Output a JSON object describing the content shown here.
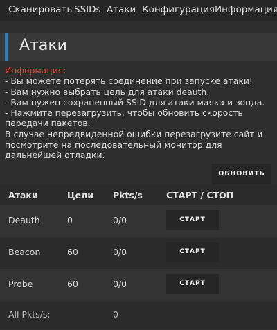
{
  "nav": {
    "items": [
      "Сканировать",
      "SSIDs",
      "Атаки",
      "Конфигурация",
      "Информация"
    ]
  },
  "page": {
    "title": "Атаки"
  },
  "info": {
    "label": "Информация:",
    "lines": [
      "- Вы можете потерять соединение при запуске атаки!",
      "- Вам нужно выбрать цель для атаки deauth.",
      "- Вам нужен сохраненный SSID для атаки маяка и зонда.",
      "- Нажмите перезагрузить, чтобы обновить скорость передачи пакетов.",
      "В случае непредвиденной ошибки перезагрузите сайт и посмотрите на последовательный монитор для дальнейшей отладки."
    ]
  },
  "reload_label": "ОБНОВИТЬ",
  "table": {
    "headers": [
      "Атаки",
      "Цели",
      "Pkts/s",
      "СТАРТ / СТОП"
    ],
    "rows": [
      {
        "attack": "Deauth",
        "targets": "0",
        "pkts": "0/0",
        "action": "СТАРТ"
      },
      {
        "attack": "Beacon",
        "targets": "60",
        "pkts": "0/0",
        "action": "СТАРТ"
      },
      {
        "attack": "Probe",
        "targets": "60",
        "pkts": "0/0",
        "action": "СТАРТ"
      }
    ],
    "total": {
      "label": "All Pkts/s:",
      "value": "0"
    }
  },
  "colors": {
    "accent": "#2a7fc1",
    "info_label": "#e0443a"
  }
}
